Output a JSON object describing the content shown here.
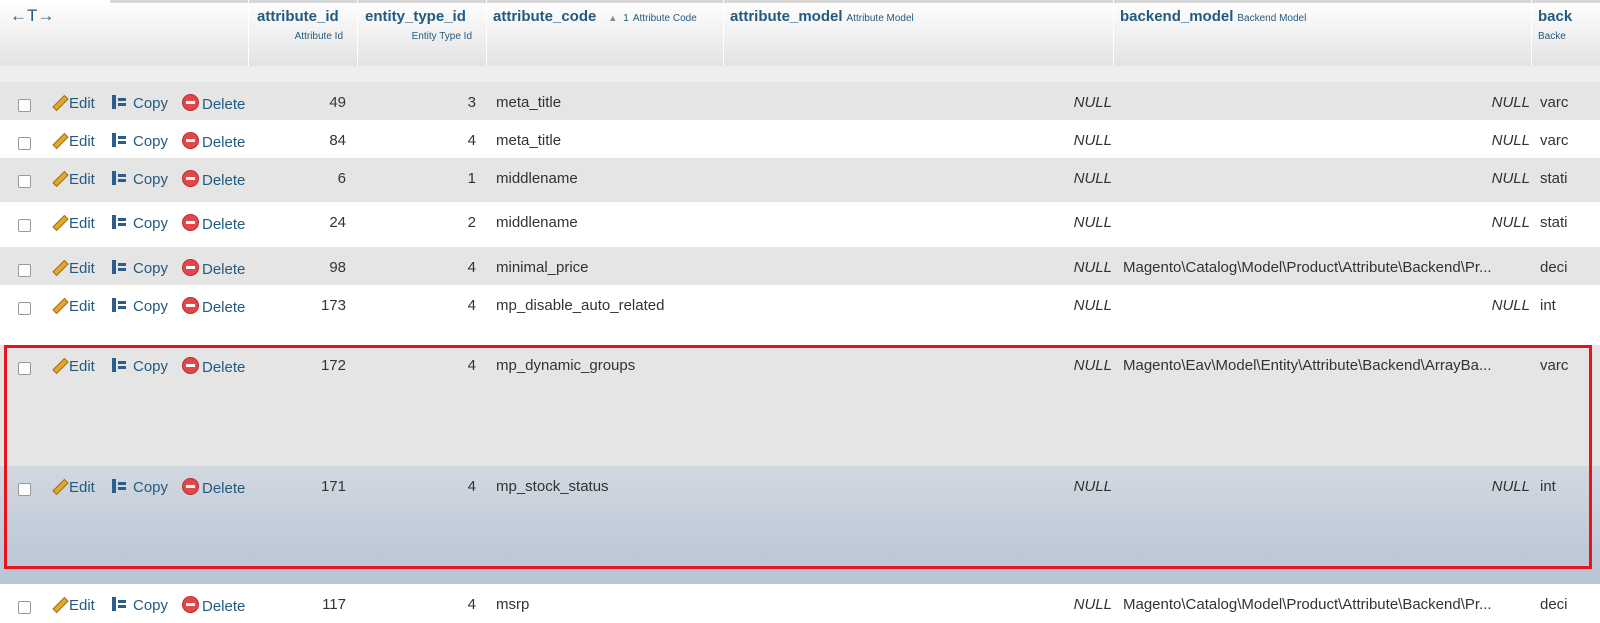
{
  "header": {
    "arrows": "←T→",
    "columns": [
      {
        "name": "attribute_id",
        "comment": "Attribute Id"
      },
      {
        "name": "entity_type_id",
        "comment": "Entity Type Id"
      },
      {
        "name": "attribute_code",
        "sort_order": "1",
        "comment": "Attribute Code"
      },
      {
        "name": "attribute_model",
        "comment": "Attribute Model"
      },
      {
        "name": "backend_model",
        "comment": "Backend Model"
      },
      {
        "name": "back",
        "comment": "Backe"
      }
    ]
  },
  "actions": {
    "edit": "Edit",
    "copy": "Copy",
    "delete": "Delete"
  },
  "colors": {
    "link": "#235a81",
    "row_even": "#e5e5e5",
    "row_odd": "#ffffff",
    "row_marked": "#c3cedb",
    "highlight_border": "#e8141d"
  },
  "rows": [
    {
      "attribute_id": "49",
      "entity_type_id": "3",
      "attribute_code": "meta_title",
      "attribute_model": "NULL",
      "backend_model": "",
      "backend_null": "NULL",
      "backend_type": "varc"
    },
    {
      "attribute_id": "84",
      "entity_type_id": "4",
      "attribute_code": "meta_title",
      "attribute_model": "NULL",
      "backend_model": "",
      "backend_null": "NULL",
      "backend_type": "varc"
    },
    {
      "attribute_id": "6",
      "entity_type_id": "1",
      "attribute_code": "middlename",
      "attribute_model": "NULL",
      "backend_model": "",
      "backend_null": "NULL",
      "backend_type": "stati"
    },
    {
      "attribute_id": "24",
      "entity_type_id": "2",
      "attribute_code": "middlename",
      "attribute_model": "NULL",
      "backend_model": "",
      "backend_null": "NULL",
      "backend_type": "stati"
    },
    {
      "attribute_id": "98",
      "entity_type_id": "4",
      "attribute_code": "minimal_price",
      "attribute_model": "NULL",
      "backend_model": "Magento\\Catalog\\Model\\Product\\Attribute\\Backend\\Pr...",
      "backend_null": "",
      "backend_type": "deci"
    },
    {
      "attribute_id": "173",
      "entity_type_id": "4",
      "attribute_code": "mp_disable_auto_related",
      "attribute_model": "NULL",
      "backend_model": "",
      "backend_null": "NULL",
      "backend_type": "int"
    },
    {
      "attribute_id": "172",
      "entity_type_id": "4",
      "attribute_code": "mp_dynamic_groups",
      "attribute_model": "NULL",
      "backend_model": "Magento\\Eav\\Model\\Entity\\Attribute\\Backend\\ArrayBa...",
      "backend_null": "",
      "backend_type": "varc"
    },
    {
      "attribute_id": "171",
      "entity_type_id": "4",
      "attribute_code": "mp_stock_status",
      "attribute_model": "NULL",
      "backend_model": "",
      "backend_null": "NULL",
      "backend_type": "int"
    },
    {
      "attribute_id": "117",
      "entity_type_id": "4",
      "attribute_code": "msrp",
      "attribute_model": "NULL",
      "backend_model": "Magento\\Catalog\\Model\\Product\\Attribute\\Backend\\Pr...",
      "backend_null": "",
      "backend_type": "deci"
    }
  ]
}
